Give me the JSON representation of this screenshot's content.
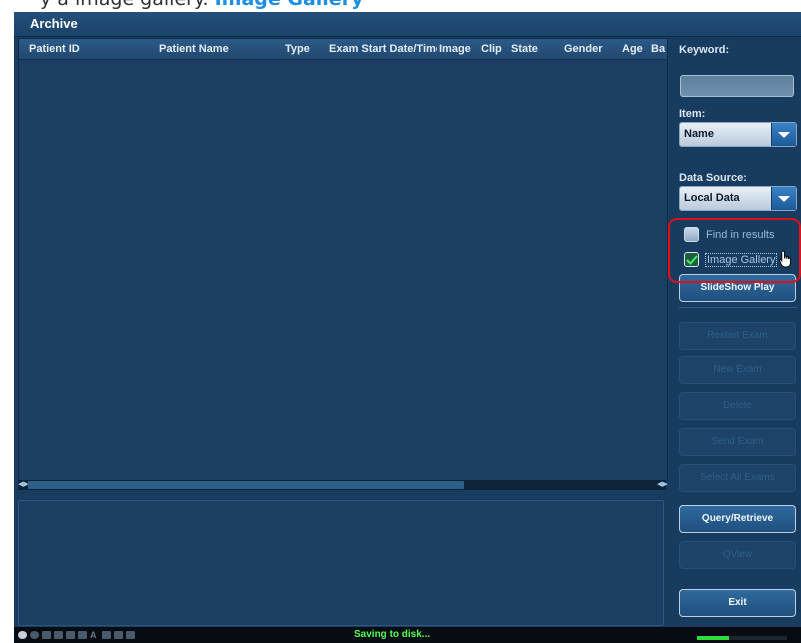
{
  "caption": {
    "prefix": "y a image gallery.",
    "highlight": "Image Gallery"
  },
  "window": {
    "title": "Archive"
  },
  "table": {
    "columns": [
      "Patient ID",
      "Patient Name",
      "Type",
      "Exam Start Date/Time",
      "Image",
      "Clip",
      "State",
      "Gender",
      "Age",
      "Ba"
    ],
    "rows": []
  },
  "sidebar": {
    "keyword_label": "Keyword:",
    "keyword_value": "",
    "item_label": "Item:",
    "item_value": "Name",
    "data_source_label": "Data Source:",
    "data_source_value": "Local Data",
    "find_in_results_label": "Find in results",
    "find_in_results_checked": false,
    "image_gallery_label": "Image Gallery",
    "image_gallery_checked": true,
    "slideshow_label": "SlideShow Play",
    "restart_label": "Restart Exam",
    "new_exam_label": "New Exam",
    "delete_label": "Delete",
    "send_label": "Send Exam",
    "select_all_label": "Select All Exams",
    "query_label": "Query/Retrieve",
    "qview_label": "QView",
    "exit_label": "Exit"
  },
  "status": {
    "text": "Saving to disk...",
    "progress": 0.35
  },
  "colors": {
    "highlight_box": "#e0101a",
    "status_text": "#55ff55",
    "progress_fill": "#2bdc3a"
  }
}
